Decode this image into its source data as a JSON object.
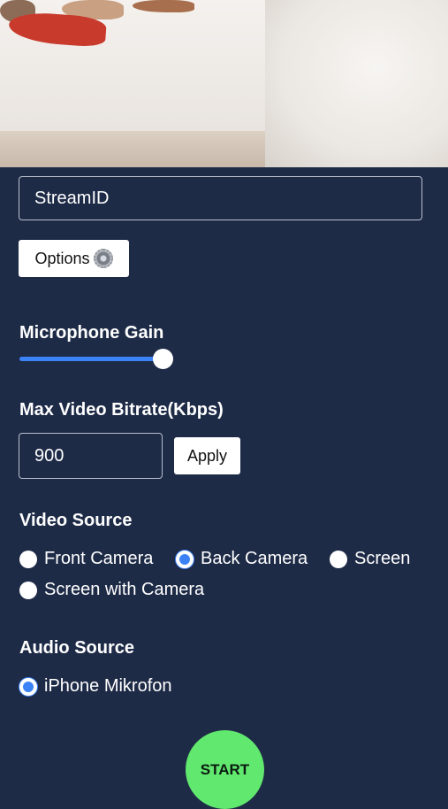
{
  "stream": {
    "placeholder": "StreamID"
  },
  "options": {
    "label": "Options"
  },
  "microphone": {
    "label": "Microphone Gain",
    "gain_fraction": 1.0
  },
  "bitrate": {
    "label": "Max Video Bitrate(Kbps)",
    "value": "900",
    "apply_label": "Apply"
  },
  "video_source": {
    "label": "Video Source",
    "options": [
      "Front Camera",
      "Back Camera",
      "Screen",
      "Screen with Camera"
    ],
    "selected": "Back Camera"
  },
  "audio_source": {
    "label": "Audio Source",
    "options": [
      "iPhone Mikrofon"
    ],
    "selected": "iPhone Mikrofon"
  },
  "start": {
    "label": "START"
  },
  "colors": {
    "background": "#1e2b47",
    "accent": "#3b82f6",
    "start": "#61e86e"
  }
}
